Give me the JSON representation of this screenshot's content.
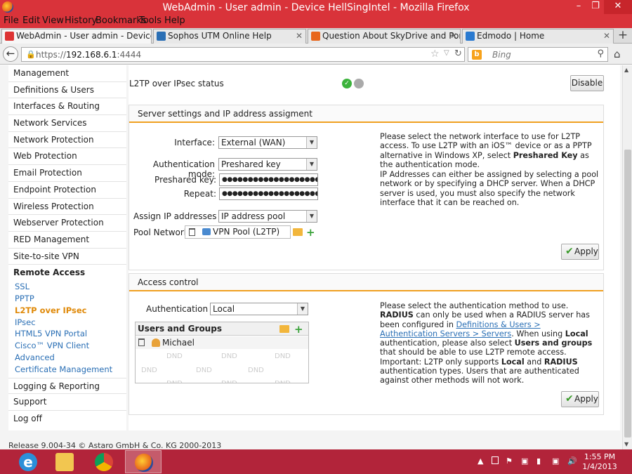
{
  "window": {
    "title": "WebAdmin - User admin - Device HellSingIntel - Mozilla Firefox"
  },
  "menu": [
    "File",
    "Edit",
    "View",
    "History",
    "Bookmarks",
    "Tools",
    "Help"
  ],
  "tabs": [
    {
      "label": "WebAdmin - User admin - Device He...",
      "active": true
    },
    {
      "label": "Sophos UTM Online Help",
      "active": false
    },
    {
      "label": "Question About SkyDrive and Ports - ...",
      "active": false
    },
    {
      "label": "Edmodo | Home",
      "active": false
    }
  ],
  "navbar": {
    "url_prefix": "https://",
    "url_host": "192.168.6.1",
    "url_suffix": ":4444",
    "search_placeholder": "Bing"
  },
  "sidebar": {
    "items_top": [
      "Management",
      "Definitions & Users",
      "Interfaces & Routing",
      "Network Services",
      "Network Protection",
      "Web Protection",
      "Email Protection",
      "Endpoint Protection",
      "Wireless Protection",
      "Webserver Protection",
      "RED Management",
      "Site-to-site VPN"
    ],
    "section": "Remote Access",
    "sub_items": [
      "SSL",
      "PPTP",
      "L2TP over IPsec",
      "IPsec",
      "HTML5 VPN Portal",
      "Cisco™ VPN Client",
      "Advanced",
      "Certificate Management"
    ],
    "current_sub": "L2TP over IPsec",
    "items_bottom": [
      "Logging & Reporting",
      "Support",
      "Log off"
    ]
  },
  "status": {
    "label": "L2TP over IPsec status",
    "disable_label": "Disable"
  },
  "server_settings": {
    "title": "Server settings and IP address assigment",
    "interface_label": "Interface:",
    "interface_value": "External (WAN)",
    "auth_mode_label": "Authentication mode:",
    "auth_mode_value": "Preshared key",
    "psk_label": "Preshared key:",
    "psk_value": "●●●●●●●●●●●●●●●●●●●●●",
    "repeat_label": "Repeat:",
    "repeat_value": "●●●●●●●●●●●●●●●●●●●●●",
    "assign_label": "Assign IP addresses by",
    "assign_value": "IP address pool",
    "pool_label": "Pool Network:",
    "pool_value": "VPN Pool (L2TP)",
    "help1": "Please select the network interface to use for L2TP access. To use L2TP with an iOS™ device or as a PPTP alternative in Windows XP, select ",
    "help1_bold": "Preshared Key",
    "help1_end": " as the authentication mode.",
    "help2": "IP Addresses can either be assigned by selecting a pool network or by specifying a DHCP server. When a DHCP server is used, you must also specify the network interface that it can be reached on.",
    "apply_label": "Apply"
  },
  "access_control": {
    "title": "Access control",
    "auth_via_label": "Authentication via:",
    "auth_via_value": "Local",
    "users_groups_title": "Users and Groups",
    "user": "Michael",
    "dnd": "DND",
    "help_a": "Please select the authentication method to use. ",
    "help_b": "RADIUS",
    "help_c": " can only be used when a RADIUS server has been configured in ",
    "help_link": "Definitions & Users > Authentication Servers > Servers",
    "help_d": ". When using ",
    "help_e": "Local",
    "help_f": " authentication, please also select ",
    "help_g": "Users and groups",
    "help_h": " that should be able to use L2TP remote access. Important: L2TP only supports ",
    "help_i": "Local",
    "help_j": " and ",
    "help_k": "RADIUS",
    "help_l": " authentication types. Users that are authenticated against other methods will not work.",
    "apply_label": "Apply"
  },
  "footer": {
    "release": "Release 9.004-34 © Astaro GmbH & Co. KG 2000-2013"
  },
  "taskbar": {
    "apps": [
      "internet-explorer-icon",
      "file-explorer-icon",
      "chrome-icon",
      "firefox-icon"
    ],
    "time": "1:55 PM",
    "date": "1/4/2013"
  },
  "colors": {
    "window_chrome": "#d9333a",
    "taskbar": "#b2243a",
    "accent_orange": "#e08a0a",
    "link_blue": "#2a6fb5"
  }
}
